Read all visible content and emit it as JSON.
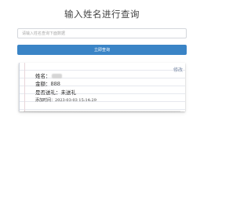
{
  "header": {
    "title": "输入姓名进行查询"
  },
  "search": {
    "placeholder": "请输入姓名查询下面数据",
    "value": ""
  },
  "query_button": {
    "label": "立即查询"
  },
  "result_card": {
    "edit_label": "修改",
    "name_label": "姓名：",
    "amount_label": "金额：",
    "amount_value": "888",
    "arrived_label": "是否送礼：",
    "arrived_value": "未送礼",
    "added_label": "添加时间：",
    "added_value": "2023-03-03 15:14:29"
  }
}
